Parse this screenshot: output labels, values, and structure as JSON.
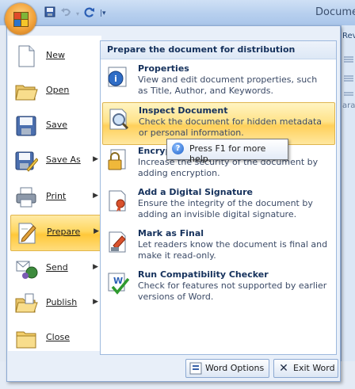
{
  "window": {
    "title": "Docume",
    "ribbon_tab_partial": "Rev",
    "ribbon_group_partial": "arag"
  },
  "quick_access": {
    "save_icon": "save-icon",
    "undo_icon": "undo-icon",
    "redo_icon": "redo-icon",
    "customize_icon": "customize-dropdown-icon"
  },
  "left_menu": {
    "items": [
      {
        "label": "New",
        "icon": "new-document-icon",
        "has_arrow": false
      },
      {
        "label": "Open",
        "icon": "open-folder-icon",
        "has_arrow": false
      },
      {
        "label": "Save",
        "icon": "save-disk-icon",
        "has_arrow": false
      },
      {
        "label": "Save As",
        "icon": "save-as-icon",
        "has_arrow": true
      },
      {
        "label": "Print",
        "icon": "printer-icon",
        "has_arrow": true
      },
      {
        "label": "Prepare",
        "icon": "prepare-icon",
        "has_arrow": true,
        "selected": true
      },
      {
        "label": "Send",
        "icon": "send-icon",
        "has_arrow": true
      },
      {
        "label": "Publish",
        "icon": "publish-icon",
        "has_arrow": true
      },
      {
        "label": "Close",
        "icon": "close-folder-icon",
        "has_arrow": false
      }
    ]
  },
  "submenu": {
    "header": "Prepare the document for distribution",
    "items": [
      {
        "title": "Properties",
        "description": "View and edit document properties, such as Title, Author, and Keywords.",
        "icon": "properties-icon"
      },
      {
        "title": "Inspect Document",
        "description": "Check the document for hidden metadata or personal information.",
        "icon": "inspect-document-icon",
        "highlighted": true
      },
      {
        "title": "Encrypt",
        "description": "Increase the security of the document by adding encryption.",
        "icon": "encrypt-lock-icon"
      },
      {
        "title": "Add a Digital Signature",
        "description": "Ensure the integrity of the document by adding an invisible digital signature.",
        "icon": "digital-signature-icon"
      },
      {
        "title": "Mark as Final",
        "description": "Let readers know the document is final and make it read-only.",
        "icon": "mark-final-icon"
      },
      {
        "title": "Run Compatibility Checker",
        "description": "Check for features not supported by earlier versions of Word.",
        "icon": "compatibility-checker-icon"
      }
    ]
  },
  "tooltip": {
    "text": "Press F1 for more help.",
    "icon": "help-icon"
  },
  "footer": {
    "options_label": "Word Options",
    "exit_label": "Exit Word"
  },
  "colors": {
    "highlight": "#ffd760",
    "menu_bg": "#e8eff9",
    "header_text": "#15315c"
  }
}
